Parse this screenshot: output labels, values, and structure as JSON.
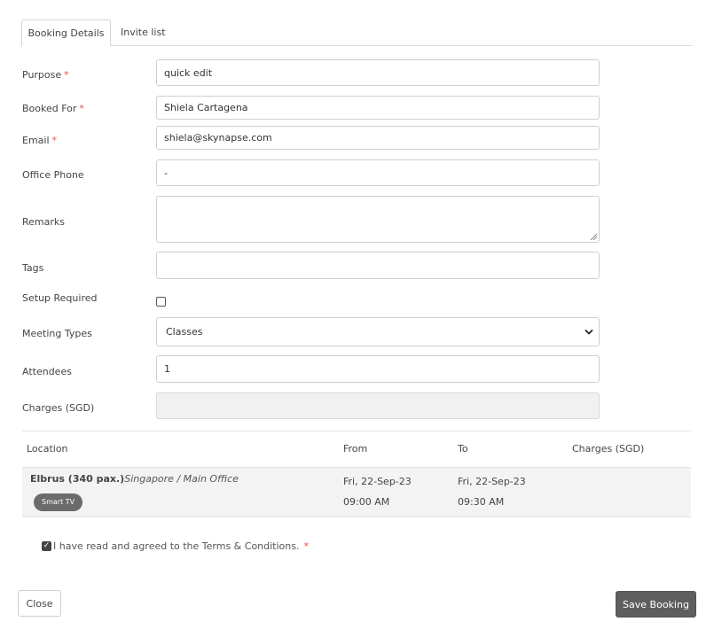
{
  "tabs": [
    {
      "label": "Booking Details"
    },
    {
      "label": "Invite list"
    }
  ],
  "form": {
    "required_mark": "*",
    "purpose": {
      "label": "Purpose",
      "value": "quick edit"
    },
    "booked_for": {
      "label": "Booked For",
      "value": "Shiela Cartagena"
    },
    "email": {
      "label": "Email",
      "value": "shiela@skynapse.com"
    },
    "office_phone": {
      "label": "Office Phone",
      "value": "-"
    },
    "remarks": {
      "label": "Remarks",
      "value": ""
    },
    "tags": {
      "label": "Tags",
      "value": ""
    },
    "setup_required": {
      "label": "Setup Required",
      "checked": false
    },
    "meeting_types": {
      "label": "Meeting Types",
      "selected": "Classes"
    },
    "attendees": {
      "label": "Attendees",
      "value": "1"
    },
    "charges": {
      "label": "Charges (SGD)",
      "value": ""
    }
  },
  "table": {
    "headers": {
      "location": "Location",
      "from": "From",
      "to": "To",
      "charges": "Charges (SGD)"
    },
    "rows": [
      {
        "location_name": "Elbrus (340 pax.)",
        "location_site": "Singapore / Main Office",
        "badge": "Smart TV",
        "from_date": "Fri, 22-Sep-23",
        "from_time": "09:00 AM",
        "to_date": "Fri, 22-Sep-23",
        "to_time": "09:30 AM",
        "charges": ""
      }
    ]
  },
  "terms": {
    "text": "I have read and agreed to the Terms & Conditions.",
    "required_mark": "*",
    "checked": true
  },
  "buttons": {
    "close": "Close",
    "save": "Save Booking"
  }
}
